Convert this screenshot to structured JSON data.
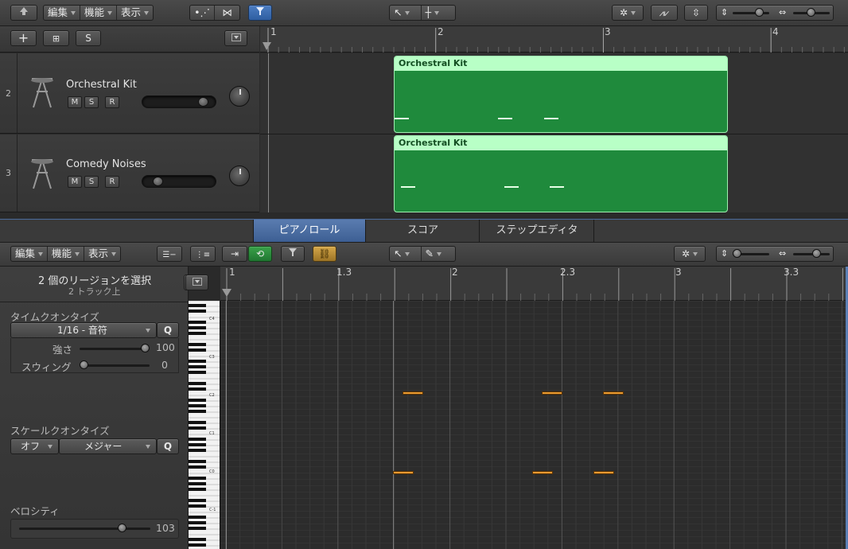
{
  "top_toolbar": {
    "edit": "編集",
    "function": "機能",
    "view": "表示"
  },
  "track_list_header": {
    "add": "+",
    "s": "S"
  },
  "ruler_top": [
    "1",
    "2",
    "3",
    "4"
  ],
  "tracks": [
    {
      "number": "2",
      "name": "Orchestral Kit",
      "m": "M",
      "s": "S",
      "r": "R",
      "volume": 0.85
    },
    {
      "number": "3",
      "name": "Comedy Noises",
      "m": "M",
      "s": "S",
      "r": "R",
      "volume": 0.2
    }
  ],
  "regions": [
    {
      "title": "Orchestral Kit"
    },
    {
      "title": "Orchestral Kit"
    }
  ],
  "editor_tabs": [
    "ピアノロール",
    "スコア",
    "ステップエディタ"
  ],
  "editor_toolbar": {
    "edit": "編集",
    "function": "機能",
    "view": "表示"
  },
  "inspector": {
    "selection": "2 個のリージョンを選択",
    "selection_sub": "2 トラック上",
    "time_quantize_label": "タイムクオンタイズ",
    "time_quantize_value": "1/16 - 音符",
    "q": "Q",
    "strength_label": "強さ",
    "strength_value": "100",
    "swing_label": "スウィング",
    "swing_value": "0",
    "scale_quantize_label": "スケールクオンタイズ",
    "scale_off": "オフ",
    "scale_major": "メジャー",
    "velocity_label": "ベロシティ",
    "velocity_value": "103"
  },
  "ruler_bottom": [
    "1",
    "1.3",
    "2",
    "2.3",
    "3",
    "3.3"
  ],
  "piano_keys": [
    "C4",
    "C3",
    "C2",
    "C1",
    "C0",
    "C-1"
  ],
  "colors": {
    "region_fill": "#1f8a3c",
    "region_header": "#b8ffc6",
    "note": "#e89a32",
    "tab_active": "#4a6a9c"
  }
}
